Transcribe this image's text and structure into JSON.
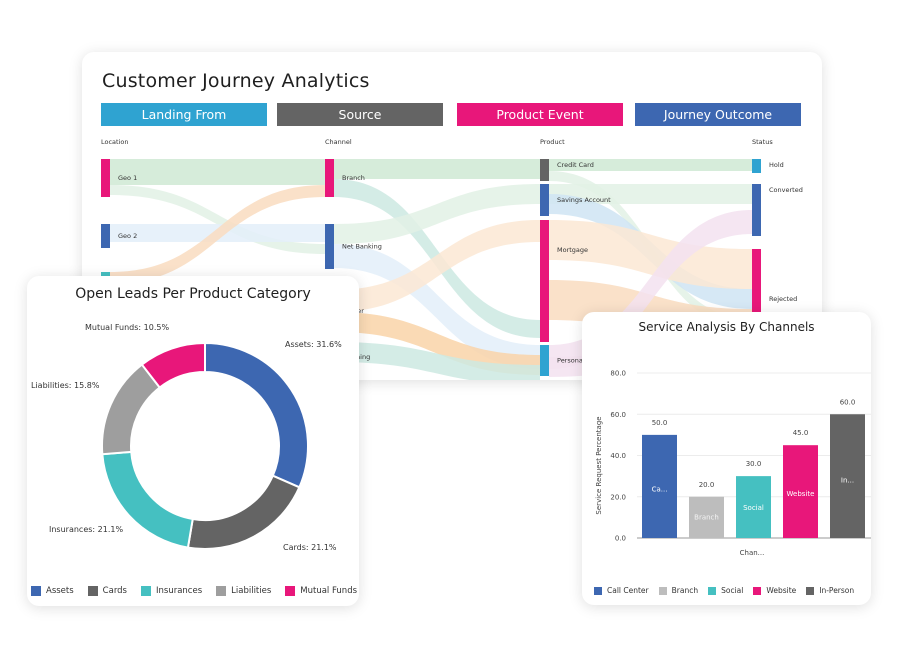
{
  "journey": {
    "title": "Customer Journey Analytics",
    "stages": [
      {
        "label": "Landing From",
        "color": "#2fa3d1"
      },
      {
        "label": "Source",
        "color": "#646464"
      },
      {
        "label": "Product Event",
        "color": "#e8177a"
      },
      {
        "label": "Journey Outcome",
        "color": "#3d67b1"
      }
    ],
    "columns": [
      "Location",
      "Channel",
      "Product",
      "Status"
    ],
    "nodes": {
      "location": [
        {
          "label": "Geo 1",
          "color": "#e8177a"
        },
        {
          "label": "Geo 2",
          "color": "#3d67b1"
        },
        {
          "label": "",
          "color": "#45c0c1"
        }
      ],
      "channel": [
        {
          "label": "Branch",
          "color": "#e8177a"
        },
        {
          "label": "Net Banking",
          "color": "#3d67b1"
        },
        {
          "label": "Center",
          "color": "#f6a35c"
        },
        {
          "label": "paigning",
          "color": "#45c0c1"
        }
      ],
      "product": [
        {
          "label": "Credit Card",
          "color": "#646464"
        },
        {
          "label": "Savings Account",
          "color": "#3d67b1"
        },
        {
          "label": "Mortgage",
          "color": "#e8177a"
        },
        {
          "label": "Persona",
          "color": "#2fa3d1"
        }
      ],
      "status": [
        {
          "label": "Hold",
          "color": "#2fa3d1"
        },
        {
          "label": "Converted",
          "color": "#3d67b1"
        },
        {
          "label": "Rejected",
          "color": "#e8177a"
        }
      ]
    }
  },
  "donut": {
    "title": "Open Leads Per Product Category",
    "legend": [
      "Assets",
      "Cards",
      "Insurances",
      "Liabilities",
      "Mutual Funds"
    ]
  },
  "bars": {
    "title": "Service Analysis By Channels",
    "legend": [
      "Call Center",
      "Branch",
      "Social",
      "Website",
      "In-Person"
    ]
  },
  "chart_data": [
    {
      "type": "pie",
      "title": "Open Leads Per Product Category",
      "categories": [
        "Assets",
        "Cards",
        "Insurances",
        "Liabilities",
        "Mutual Funds"
      ],
      "values": [
        31.6,
        21.1,
        21.1,
        15.8,
        10.5
      ],
      "labels": [
        "Assets: 31.6%",
        "Cards: 21.1%",
        "Insurances: 21.1%",
        "Liabilities: 15.8%",
        "Mutual Funds: 10.5%"
      ],
      "colors": [
        "#3d67b1",
        "#646464",
        "#45c0c1",
        "#9e9e9e",
        "#e8177a"
      ],
      "donut": true,
      "legend": "bottom"
    },
    {
      "type": "bar",
      "title": "Service Analysis By Channels",
      "categories": [
        "Call Center",
        "Branch",
        "Social",
        "Website",
        "In-Person"
      ],
      "values": [
        50.0,
        20.0,
        30.0,
        45.0,
        60.0
      ],
      "bar_labels": [
        "Ca...",
        "Branch",
        "Social",
        "Website",
        "In..."
      ],
      "value_labels": [
        "50.0",
        "20.0",
        "30.0",
        "45.0",
        "60.0"
      ],
      "colors": [
        "#3d67b1",
        "#bdbdbd",
        "#45c0c1",
        "#e8177a",
        "#646464"
      ],
      "xlabel": "Chan...",
      "ylabel": "Service Request Percentage",
      "yticks": [
        "0.0",
        "20.0",
        "40.0",
        "60.0",
        "80.0"
      ],
      "ylim": [
        0,
        80
      ],
      "grid": true,
      "legend": "bottom"
    }
  ]
}
